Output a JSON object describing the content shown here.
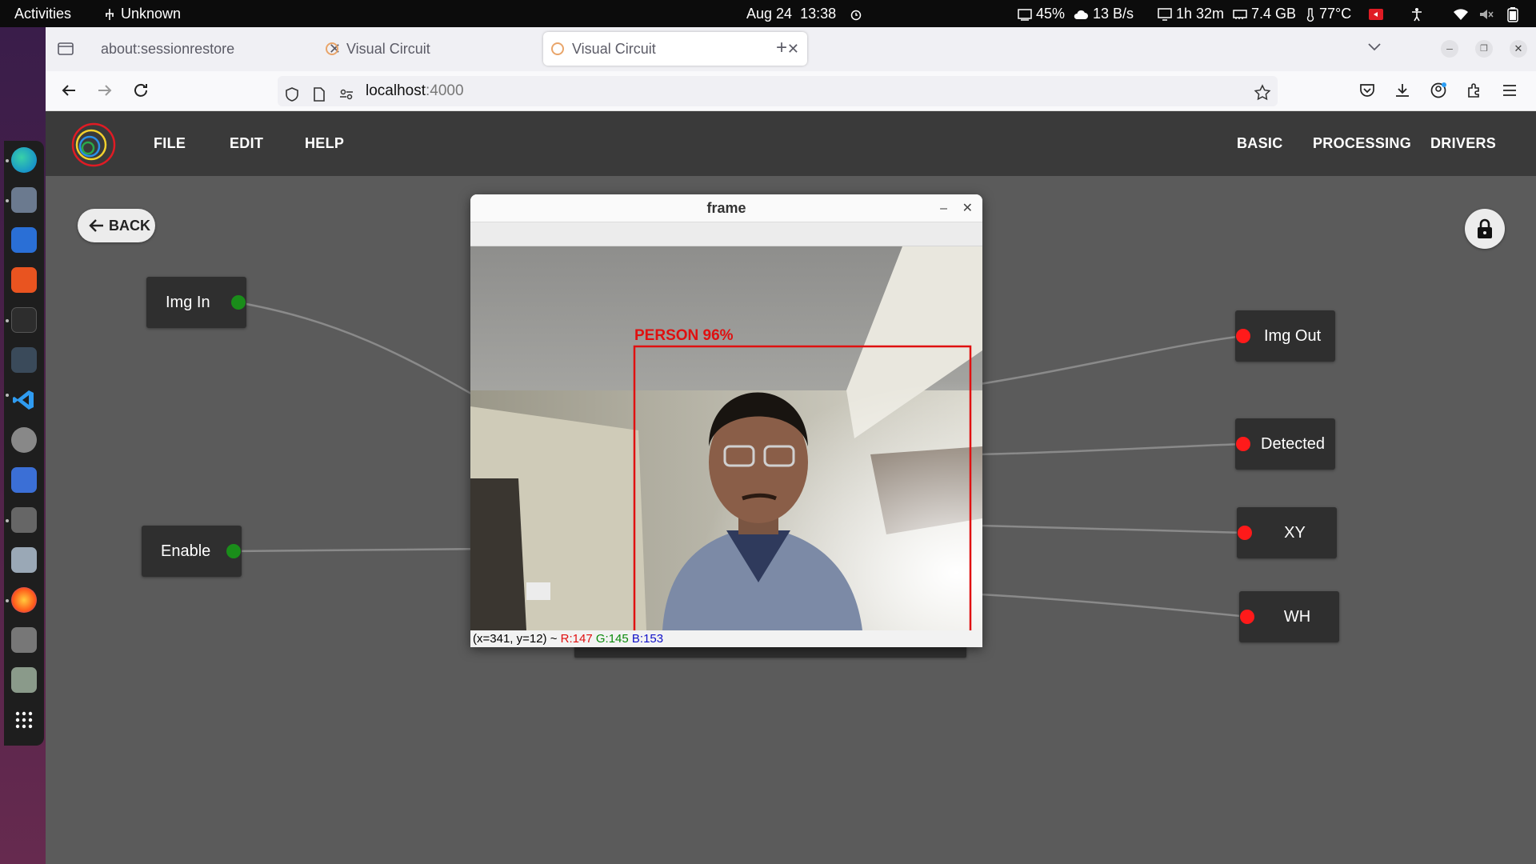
{
  "system_bar": {
    "activities": "Activities",
    "network_indicator": "Unknown",
    "date": "Aug 24",
    "time": "13:38",
    "cpu_usage": "45%",
    "network_speed": "13 B/s",
    "uptime": "1h 32m",
    "memory": "7.4 GB",
    "temperature": "77°C"
  },
  "browser": {
    "tabs": [
      {
        "title": "about:sessionrestore",
        "active": false
      },
      {
        "title": "Visual Circuit",
        "active": false
      },
      {
        "title": "Visual Circuit",
        "active": true
      }
    ],
    "url_host": "localhost",
    "url_port": ":4000"
  },
  "app": {
    "menu_left": [
      "FILE",
      "EDIT",
      "HELP"
    ],
    "menu_right": [
      "BASIC",
      "PROCESSING",
      "DRIVERS"
    ],
    "back_label": "BACK",
    "nodes": {
      "img_in": "Img In",
      "enable": "Enable",
      "img_out": "Img Out",
      "detected": "Detected",
      "xy": "XY",
      "wh": "WH"
    },
    "colors": {
      "input_port": "#1a8d1a",
      "output_port": "#ff1a1a",
      "header_bg": "#3a3a3a",
      "canvas_bg": "#5b5b5b"
    }
  },
  "frame_window": {
    "title": "frame",
    "detection_label": "PERSON 96%",
    "detection_color": "#e01010",
    "status_coords": "(x=341, y=12) ~",
    "status_r": "R:147",
    "status_g": "G:145",
    "status_b": "B:153"
  }
}
